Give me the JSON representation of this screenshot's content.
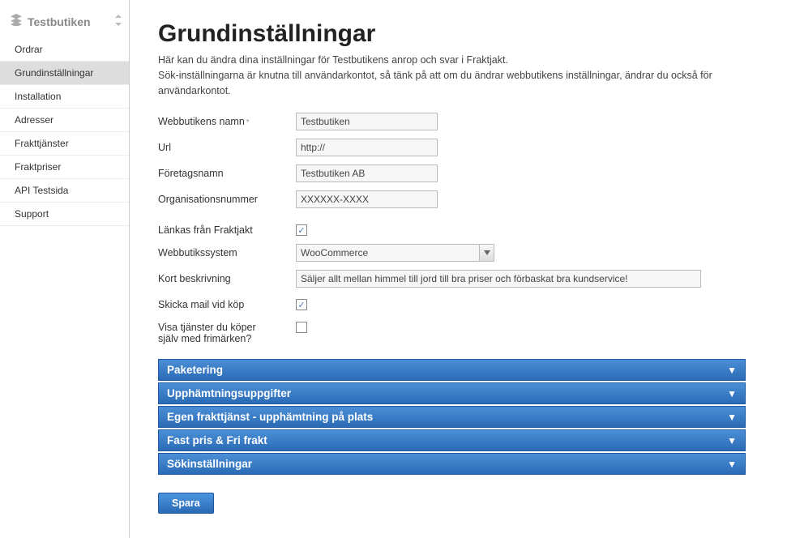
{
  "sidebar": {
    "title": "Testbutiken",
    "items": [
      {
        "label": "Ordrar"
      },
      {
        "label": "Grundinställningar",
        "selected": true
      },
      {
        "label": "Installation"
      },
      {
        "label": "Adresser"
      },
      {
        "label": "Frakttjänster"
      },
      {
        "label": "Fraktpriser"
      },
      {
        "label": "API Testsida"
      },
      {
        "label": "Support"
      }
    ]
  },
  "page": {
    "title": "Grundinställningar",
    "subtitle1": "Här kan du ändra dina inställningar för Testbutikens anrop och svar i Fraktjakt.",
    "subtitle2": "Sök-inställningarna är knutna till användarkontot, så tänk på att om du ändrar webbutikens inställningar, ändrar du också för användarkontot."
  },
  "form": {
    "webshop_name": {
      "label": "Webbutikens namn",
      "required": "*",
      "value": "Testbutiken"
    },
    "url": {
      "label": "Url",
      "value": "http://"
    },
    "company_name": {
      "label": "Företagsnamn",
      "value": "Testbutiken AB"
    },
    "org_number": {
      "label": "Organisationsnummer",
      "value": "XXXXXX-XXXX"
    },
    "link_from_fraktjakt": {
      "label": "Länkas från Fraktjakt",
      "checked": true
    },
    "webshop_system": {
      "label": "Webbutikssystem",
      "value": "WooCommerce"
    },
    "short_desc": {
      "label": "Kort beskrivning",
      "value": "Säljer allt mellan himmel till jord till bra priser och förbaskat bra kundservice!"
    },
    "send_mail": {
      "label": "Skicka mail vid köp",
      "checked": true
    },
    "show_services": {
      "label1": "Visa tjänster du köper",
      "label2": "själv med frimärken?",
      "checked": false
    }
  },
  "panels": [
    {
      "label": "Paketering"
    },
    {
      "label": "Upphämtningsuppgifter"
    },
    {
      "label": "Egen frakttjänst - upphämtning på plats"
    },
    {
      "label": "Fast pris & Fri frakt"
    },
    {
      "label": "Sökinställningar"
    }
  ],
  "buttons": {
    "save": "Spara"
  }
}
